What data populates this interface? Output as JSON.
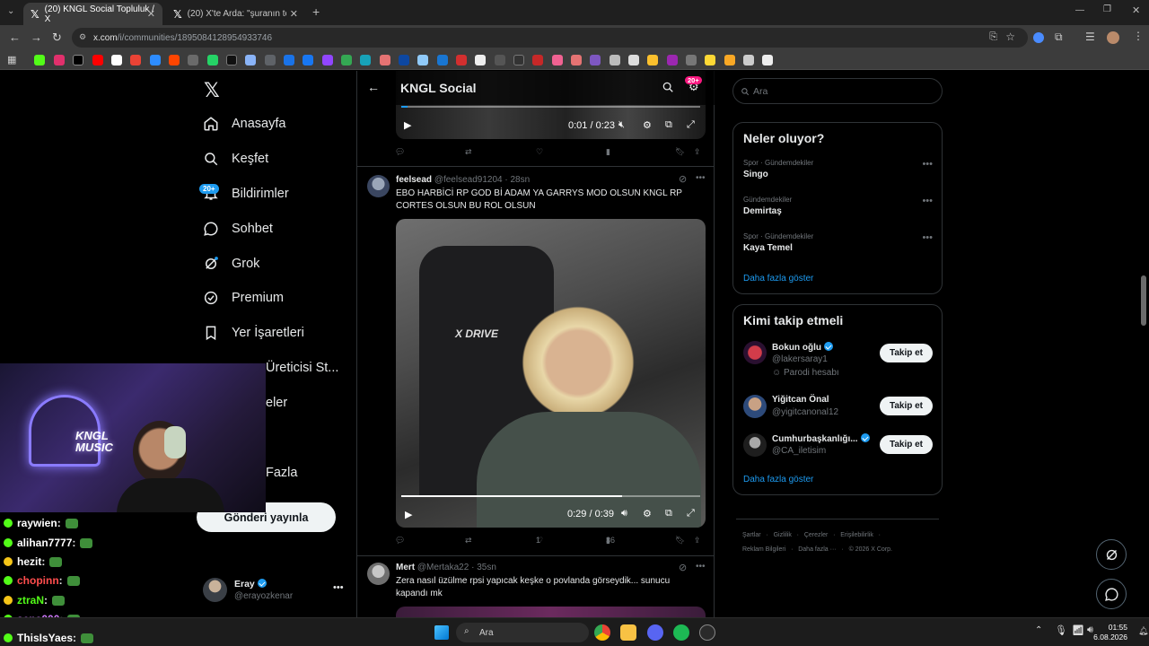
{
  "browser": {
    "tabs": [
      {
        "title": "(20) KNGL Social Topluluk / X",
        "active": true
      },
      {
        "title": "(20) X'te Arda: \"şuranın tepesin",
        "active": false
      }
    ],
    "url_host": "x.com",
    "url_path": "/i/communities/1895084128954933746"
  },
  "sidebar": {
    "notifications_badge": "20+",
    "items": [
      {
        "label": "Anasayfa",
        "icon": "home-icon"
      },
      {
        "label": "Keşfet",
        "icon": "search-icon"
      },
      {
        "label": "Bildirimler",
        "icon": "bell-icon"
      },
      {
        "label": "Sohbet",
        "icon": "chat-icon"
      },
      {
        "label": "Grok",
        "icon": "grok-icon"
      },
      {
        "label": "Premium",
        "icon": "premium-icon"
      },
      {
        "label": "Yer İşaretleri",
        "icon": "bookmark-icon"
      }
    ],
    "partial_items": [
      "Üreticisi St...",
      "eler",
      "Fazla"
    ],
    "post_button": "Gönderi yayınla",
    "account": {
      "name": "Eray",
      "handle": "@erayozkenar"
    }
  },
  "feed": {
    "title": "KNGL Social",
    "settings_badge": "20+",
    "video1_time": "0:01 / 0:23",
    "tweets": [
      {
        "name": "feelsead",
        "handle": "@feelsead91204",
        "time": "28sn",
        "text": "EBO HARBİCİ RP GOD Bİ ADAM YA GARRYS MOD OLSUN KNGL RP CORTES OLSUN BU ROL OLSUN",
        "video_time": "0:29 / 0:39",
        "likes": "1",
        "views": "36"
      },
      {
        "name": "Mert",
        "handle": "@Mertaka22",
        "time": "35sn",
        "text": "Zera nasıl üzülme rpsi yapıcak keşke o povlanda görseydik... sunucu kapandı mk"
      }
    ]
  },
  "right": {
    "search_placeholder": "Ara",
    "trends_title": "Neler oluyor?",
    "trends": [
      {
        "meta": "Spor · Gündemdekiler",
        "name": "Singo"
      },
      {
        "meta": "Gündemdekiler",
        "name": "Demirtaş"
      },
      {
        "meta": "Spor · Gündemdekiler",
        "name": "Kaya Temel"
      }
    ],
    "show_more": "Daha fazla göster",
    "who_title": "Kimi takip etmeli",
    "who": [
      {
        "name": "Bokun oğlu",
        "handle": "@lakersaray1",
        "extra": "Parodi hesabı",
        "verified": true
      },
      {
        "name": "Yiğitcan Önal",
        "handle": "@yigitcanonal12",
        "extra": "",
        "verified": false
      },
      {
        "name": "Cumhurbaşkanlığı...",
        "handle": "@CA_iletisim",
        "extra": "",
        "verified": true
      }
    ],
    "follow_label": "Takip et",
    "who_show_more": "Daha fazla göster",
    "footer_line1": "Şartlar   ·   Gizlilik   ·   Çerezler   ·   Erişilebilirlik   ·",
    "footer_line2": "Reklam Bilgileri   ·   Daha fazla ···   ·   © 2026 X Corp."
  },
  "overlay": {
    "webcam_text": "KNGL MUSIC",
    "chat": [
      {
        "user": "raywien",
        "color": "#ffffff"
      },
      {
        "user": "alihan7777",
        "color": "#ffffff"
      },
      {
        "user": "hezit",
        "color": "#ffffff"
      },
      {
        "user": "chopinn",
        "color": "#ff4d4d"
      },
      {
        "user": "ztraN",
        "color": "#53fc18"
      },
      {
        "user": "sena000",
        "color": "#d17bff"
      },
      {
        "user": "ThisIsYaes",
        "color": "#ffffff"
      }
    ],
    "chat_separator": " :"
  },
  "taskbar": {
    "search": "Ara",
    "time": "01:55",
    "date": "6.08.2026"
  }
}
